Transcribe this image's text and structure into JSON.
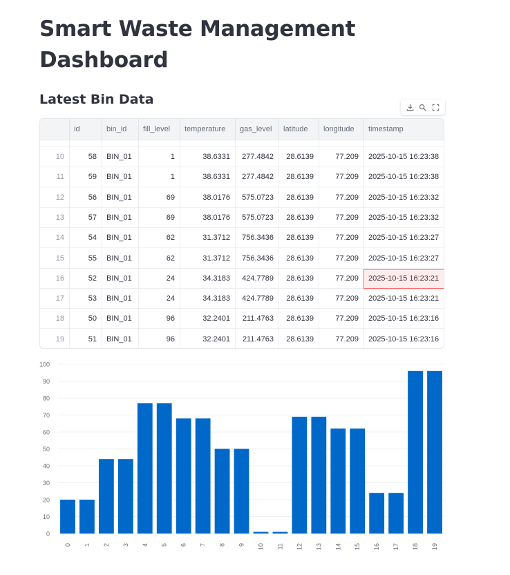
{
  "header": {
    "title": "Smart Waste Management Dashboard"
  },
  "section": {
    "title": "Latest Bin Data"
  },
  "toolbar": {
    "icons": [
      "download-icon",
      "search-icon",
      "fullscreen-icon"
    ]
  },
  "table": {
    "columns": [
      "",
      "id",
      "bin_id",
      "fill_level",
      "temperature",
      "gas_level",
      "latitude",
      "longitude",
      "timestamp"
    ],
    "rows": [
      [
        "10",
        "58",
        "BIN_01",
        "1",
        "38.6331",
        "277.4842",
        "28.6139",
        "77.209",
        "2025-10-15 16:23:38"
      ],
      [
        "11",
        "59",
        "BIN_01",
        "1",
        "38.6331",
        "277.4842",
        "28.6139",
        "77.209",
        "2025-10-15 16:23:38"
      ],
      [
        "12",
        "56",
        "BIN_01",
        "69",
        "38.0176",
        "575.0723",
        "28.6139",
        "77.209",
        "2025-10-15 16:23:32"
      ],
      [
        "13",
        "57",
        "BIN_01",
        "69",
        "38.0176",
        "575.0723",
        "28.6139",
        "77.209",
        "2025-10-15 16:23:32"
      ],
      [
        "14",
        "54",
        "BIN_01",
        "62",
        "31.3712",
        "756.3436",
        "28.6139",
        "77.209",
        "2025-10-15 16:23:27"
      ],
      [
        "15",
        "55",
        "BIN_01",
        "62",
        "31.3712",
        "756.3436",
        "28.6139",
        "77.209",
        "2025-10-15 16:23:27"
      ],
      [
        "16",
        "52",
        "BIN_01",
        "24",
        "34.3183",
        "424.7789",
        "28.6139",
        "77.209",
        "2025-10-15 16:23:21"
      ],
      [
        "17",
        "53",
        "BIN_01",
        "24",
        "34.3183",
        "424.7789",
        "28.6139",
        "77.209",
        "2025-10-15 16:23:21"
      ],
      [
        "18",
        "50",
        "BIN_01",
        "96",
        "32.2401",
        "211.4763",
        "28.6139",
        "77.209",
        "2025-10-15 16:23:16"
      ],
      [
        "19",
        "51",
        "BIN_01",
        "96",
        "32.2401",
        "211.4763",
        "28.6139",
        "77.209",
        "2025-10-15 16:23:16"
      ]
    ]
  },
  "chart_data": {
    "type": "bar",
    "categories": [
      "0",
      "1",
      "2",
      "3",
      "4",
      "5",
      "6",
      "7",
      "8",
      "9",
      "10",
      "11",
      "12",
      "13",
      "14",
      "15",
      "16",
      "17",
      "18",
      "19"
    ],
    "values": [
      20,
      20,
      44,
      44,
      77,
      77,
      68,
      68,
      50,
      50,
      1,
      1,
      69,
      69,
      62,
      62,
      24,
      24,
      96,
      96
    ],
    "yticks": [
      0,
      10,
      20,
      30,
      40,
      50,
      60,
      70,
      80,
      90,
      100
    ],
    "ylim": [
      0,
      100
    ],
    "grid": true,
    "color": "#0068c9"
  }
}
